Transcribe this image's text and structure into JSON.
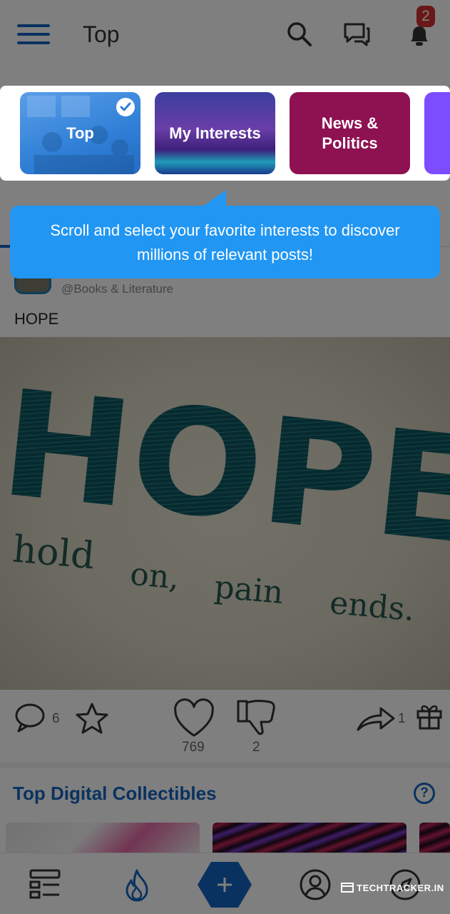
{
  "header": {
    "title": "Top",
    "notification_count": "2"
  },
  "interests": [
    {
      "label": "Top",
      "selected": true
    },
    {
      "label": "My Interests",
      "selected": false
    },
    {
      "label": "News &\nPolitics",
      "selected": false
    }
  ],
  "tooltip": {
    "line1": "Scroll and select your favorite interests to discover",
    "line2": "millions of relevant posts!"
  },
  "post": {
    "community": "@Books & Literature",
    "title": "HOPE",
    "image_text": {
      "big": "HOPE",
      "words": [
        "hold",
        "on,",
        "pain",
        "ends."
      ]
    },
    "comments": "6",
    "likes": "769",
    "dislikes": "2",
    "shares": "1"
  },
  "collectibles": {
    "heading": "Top Digital Collectibles",
    "help": "?"
  },
  "watermark": "TECHTRACKER.IN",
  "colors": {
    "primary": "#1565c0",
    "tooltip": "#2196f3",
    "chip_top": "#2f7fd6",
    "chip_interests": "#3b3f9e",
    "chip_news": "#8e1152",
    "chip_next": "#7c4dff",
    "badge": "#d32f2f"
  },
  "icons": [
    "menu-icon",
    "search-icon",
    "chat-icon",
    "bell-icon",
    "check-icon",
    "comment-icon",
    "star-icon",
    "heart-icon",
    "dislike-icon",
    "share-icon",
    "gift-icon",
    "feed-icon",
    "flame-icon",
    "plus-icon",
    "profile-icon",
    "compass-icon"
  ]
}
